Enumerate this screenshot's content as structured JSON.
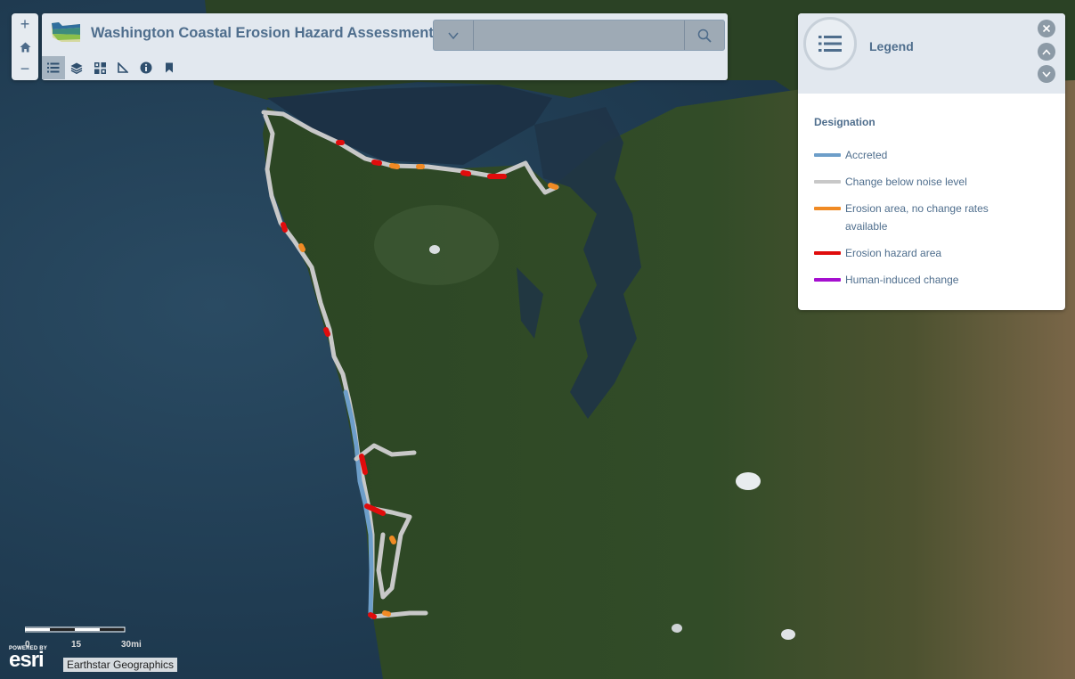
{
  "app": {
    "title": "Washington Coastal Erosion Hazard Assessment"
  },
  "zoom": {
    "zoom_in": "+",
    "home": "home-icon",
    "zoom_out": "−"
  },
  "search": {
    "placeholder": "",
    "value": ""
  },
  "toolbar": {
    "tools": [
      "legend-icon",
      "layers-icon",
      "basemap-gallery-icon",
      "measure-icon",
      "info-icon",
      "bookmark-icon"
    ],
    "active": "legend-icon"
  },
  "legend": {
    "title": "Legend",
    "field": "Designation",
    "items": [
      {
        "label": "Accreted",
        "color": "#6d9ec9"
      },
      {
        "label": "Change below noise level",
        "color": "#c8c8c8"
      },
      {
        "label": "Erosion area, no change rates available",
        "color": "#f08a24"
      },
      {
        "label": "Erosion hazard area",
        "color": "#e00c0c"
      },
      {
        "label": "Human-induced change",
        "color": "#a50fcf"
      }
    ]
  },
  "scalebar": {
    "ticks": [
      "0",
      "15",
      "30mi"
    ]
  },
  "attribution": {
    "powered_by": "POWERED BY",
    "brand": "esri",
    "text": "Earthstar Geographics"
  },
  "colors": {
    "panel_bg": "#e2e8ef",
    "title_text": "#4f6e8d",
    "ocean": "#1e3b52",
    "land": "#2f4a26"
  }
}
